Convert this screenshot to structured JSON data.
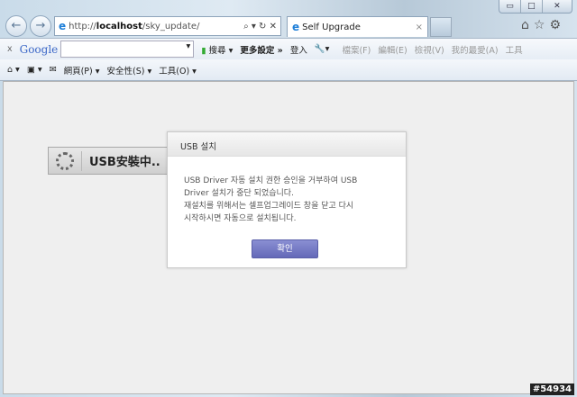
{
  "browser": {
    "url_prefix": "http://",
    "url_host": "localhost",
    "url_path": "/sky_update/",
    "tab_title": "Self Upgrade",
    "window_controls": [
      "▭",
      "□",
      "✕"
    ]
  },
  "google_toolbar": {
    "close": "x",
    "logo": "Google",
    "search_value": "",
    "search_label": "搜尋",
    "more_settings": "更多設定 »",
    "sign_in": "登入",
    "menu": [
      "檔案(F)",
      "編輯(E)",
      "檢視(V)",
      "我的最愛(A)",
      "工具"
    ]
  },
  "command_bar": {
    "page": "網頁(P)",
    "safety": "安全性(S)",
    "tools": "工具(O)"
  },
  "loading": {
    "label": "USB安裝中.."
  },
  "dialog": {
    "title": "USB 설치",
    "lines": [
      "USB Driver 자동 설치 권한 승인을 거부하여 USB",
      "Driver 설치가 중단 되었습니다.",
      "재설치를 위해서는 셀프업그레이드 창을 닫고 다시",
      "시작하시면 자동으로 설치됩니다."
    ],
    "ok": "확인"
  },
  "watermark": "#54934"
}
